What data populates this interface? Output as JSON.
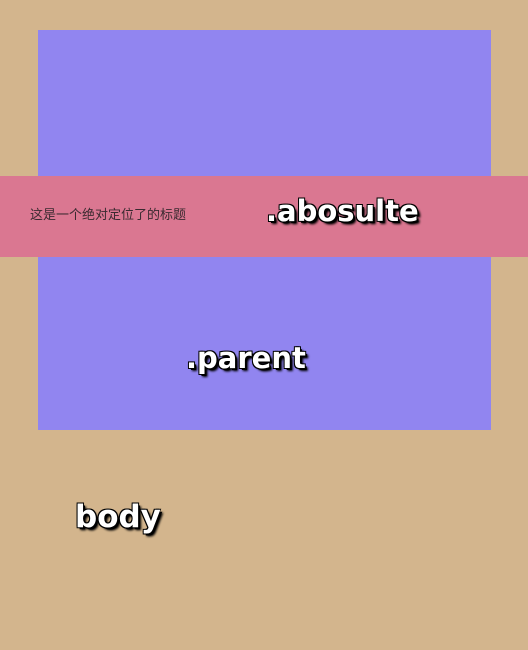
{
  "colors": {
    "body_background": "#d3b58d",
    "parent_background": "#9185f0",
    "absolute_background": "#da7791",
    "label_text": "#ffffff",
    "label_outline": "#000000"
  },
  "absolute": {
    "title_text": "这是一个绝对定位了的标题",
    "label": ".abosulte"
  },
  "parent": {
    "label": ".parent"
  },
  "body": {
    "label": "body"
  }
}
